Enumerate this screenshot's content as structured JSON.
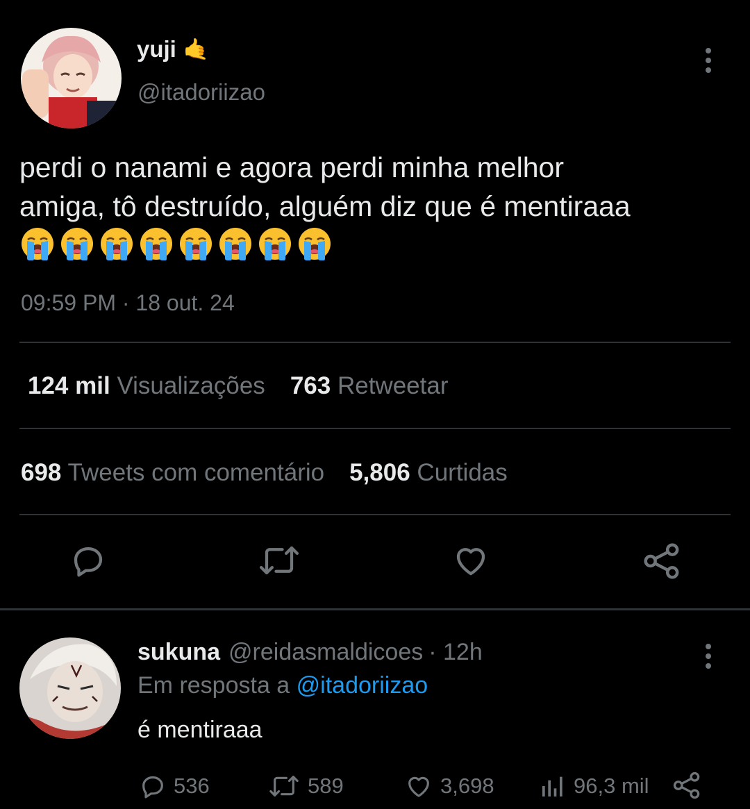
{
  "tweet": {
    "display_name": "yuji",
    "name_emoji": "🤙",
    "handle": "@itadoriizao",
    "text_line1": "perdi o nanami e agora perdi minha melhor",
    "text_line2": "amiga, tô destruído, alguém diz que é mentiraaa",
    "emoji_count": 8,
    "timestamp": "09:59 PM · 18 out. 24",
    "stats": {
      "views_num": "124 mil",
      "views_label": "Visualizações",
      "retweets_num": "763",
      "retweets_label": "Retweetar",
      "quotes_num": "698",
      "quotes_label": "Tweets com comentário",
      "likes_num": "5,806",
      "likes_label": "Curtidas"
    },
    "actions": [
      "reply-icon",
      "retweet-icon",
      "like-icon",
      "share-icon"
    ]
  },
  "reply": {
    "display_name": "sukuna",
    "handle": "@reidasmaldicoes",
    "time": "· 12h",
    "in_reply_prefix": "Em resposta a",
    "in_reply_handle": "@itadoriizao",
    "text": "é mentiraaa",
    "counts": {
      "replies": "536",
      "retweets": "589",
      "likes": "3,698",
      "views": "96,3 mil"
    }
  },
  "colors": {
    "background": "#000000",
    "text": "#e7e9ea",
    "muted": "#71767b",
    "link": "#1d9bf0",
    "divider": "#2f3336"
  }
}
